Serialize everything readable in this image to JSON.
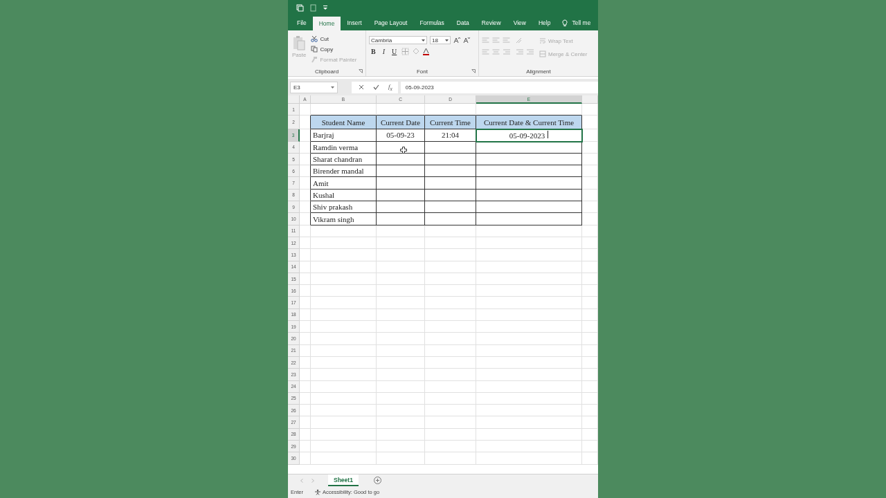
{
  "ribbon_tabs": [
    {
      "label": "File",
      "selected": false
    },
    {
      "label": "Home",
      "selected": true
    },
    {
      "label": "Insert",
      "selected": false
    },
    {
      "label": "Page Layout",
      "selected": false
    },
    {
      "label": "Formulas",
      "selected": false
    },
    {
      "label": "Data",
      "selected": false
    },
    {
      "label": "Review",
      "selected": false
    },
    {
      "label": "View",
      "selected": false
    },
    {
      "label": "Help",
      "selected": false
    }
  ],
  "tell_me": {
    "label": "Tell me"
  },
  "ribbon": {
    "clipboard": {
      "title": "Clipboard",
      "paste": {
        "label": "Paste",
        "disabled": true
      },
      "items": [
        {
          "label": "Cut",
          "kind": "cut",
          "disabled": false
        },
        {
          "label": "Copy",
          "kind": "copy",
          "disabled": false
        },
        {
          "label": "Format Painter",
          "kind": "painter",
          "disabled": true
        }
      ]
    },
    "font": {
      "title": "Font",
      "font_name": "Cambria",
      "font_size": "18",
      "styles": [
        {
          "label": "B",
          "kind": "bold"
        },
        {
          "label": "I",
          "kind": "italic"
        },
        {
          "label": "U",
          "kind": "underline"
        }
      ]
    },
    "alignment": {
      "title": "Alignment",
      "items": [
        {
          "label": "Wrap Text",
          "kind": "wrap",
          "disabled": true
        },
        {
          "label": "Merge & Center",
          "kind": "merge",
          "disabled": true
        }
      ]
    }
  },
  "formula_bar": {
    "name_box": "E3",
    "function_label": "f$_{x}$",
    "value": "05-09-2023"
  },
  "sheet": {
    "columns": [
      {
        "label": "A",
        "selected": false
      },
      {
        "label": "B",
        "selected": false
      },
      {
        "label": "C",
        "selected": false
      },
      {
        "label": "D",
        "selected": false
      },
      {
        "label": "E",
        "selected": true
      }
    ],
    "rows": [
      {
        "label": "1",
        "selected": false
      },
      {
        "label": "2",
        "selected": false
      },
      {
        "label": "3",
        "selected": true
      },
      {
        "label": "4",
        "selected": false
      },
      {
        "label": "5",
        "selected": false
      },
      {
        "label": "6",
        "selected": false
      },
      {
        "label": "7",
        "selected": false
      },
      {
        "label": "8",
        "selected": false
      },
      {
        "label": "9",
        "selected": false
      },
      {
        "label": "10",
        "selected": false
      },
      {
        "label": "11",
        "selected": false
      },
      {
        "label": "12",
        "selected": false
      },
      {
        "label": "13",
        "selected": false
      },
      {
        "label": "14",
        "selected": false
      },
      {
        "label": "15",
        "selected": false
      },
      {
        "label": "16",
        "selected": false
      },
      {
        "label": "17",
        "selected": false
      },
      {
        "label": "18",
        "selected": false
      },
      {
        "label": "19",
        "selected": false
      },
      {
        "label": "20",
        "selected": false
      },
      {
        "label": "21",
        "selected": false
      },
      {
        "label": "22",
        "selected": false
      },
      {
        "label": "23",
        "selected": false
      },
      {
        "label": "24",
        "selected": false
      },
      {
        "label": "25",
        "selected": false
      },
      {
        "label": "26",
        "selected": false
      },
      {
        "label": "27",
        "selected": false
      },
      {
        "label": "28",
        "selected": false
      },
      {
        "label": "29",
        "selected": false
      },
      {
        "label": "30",
        "selected": false
      }
    ],
    "table": {
      "columns": [
        "Student Name",
        "Current Date",
        "Current Time",
        "Current Date & Current Time"
      ],
      "rows": [
        {
          "cells": [
            "Barjraj",
            "05-09-23",
            "21:04",
            "05-09-2023"
          ],
          "editing": true
        },
        {
          "cells": [
            "Ramdin verma"
          ],
          "editing": false
        },
        {
          "cells": [
            "Sharat chandran"
          ],
          "editing": false
        },
        {
          "cells": [
            "Birender mandal"
          ],
          "editing": false
        },
        {
          "cells": [
            "Amit"
          ],
          "editing": false
        },
        {
          "cells": [
            "Kushal"
          ],
          "editing": false
        },
        {
          "cells": [
            "Shiv prakash"
          ],
          "editing": false
        },
        {
          "cells": [
            "Vikram singh"
          ],
          "editing": false
        }
      ]
    }
  },
  "sheet_tabs": [
    {
      "label": "Sheet1",
      "selected": true
    }
  ],
  "status_bar": {
    "mode": "Enter",
    "accessibility": "Accessibility: Good to go"
  }
}
